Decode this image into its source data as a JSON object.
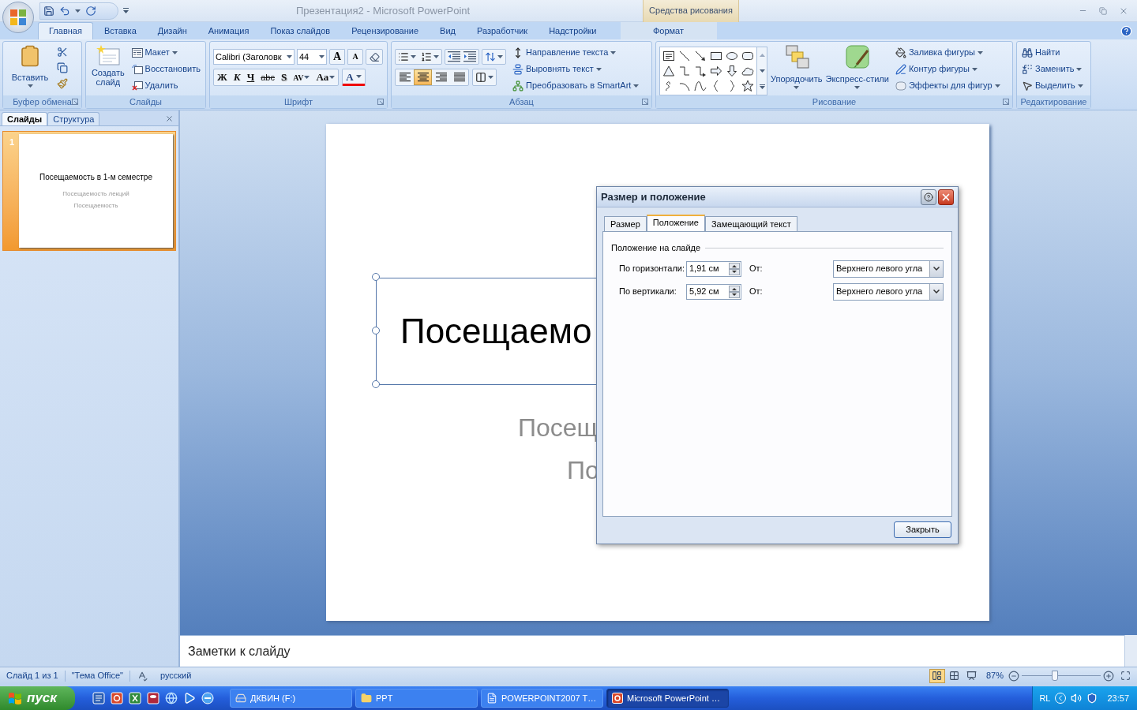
{
  "window": {
    "title": "Презентация2 - Microsoft PowerPoint",
    "contextual_group": "Средства рисования"
  },
  "ribbon_tabs": [
    {
      "label": "Главная",
      "selected": true,
      "kind": "normal"
    },
    {
      "label": "Вставка",
      "selected": false,
      "kind": "normal"
    },
    {
      "label": "Дизайн",
      "selected": false,
      "kind": "normal"
    },
    {
      "label": "Анимация",
      "selected": false,
      "kind": "normal"
    },
    {
      "label": "Показ слайдов",
      "selected": false,
      "kind": "normal"
    },
    {
      "label": "Рецензирование",
      "selected": false,
      "kind": "normal"
    },
    {
      "label": "Вид",
      "selected": false,
      "kind": "normal"
    },
    {
      "label": "Разработчик",
      "selected": false,
      "kind": "normal"
    },
    {
      "label": "Надстройки",
      "selected": false,
      "kind": "normal"
    },
    {
      "label": "Формат",
      "selected": false,
      "kind": "contextual"
    }
  ],
  "clipboard": {
    "title": "Буфер обмена",
    "paste": "Вставить"
  },
  "slides_group": {
    "title": "Слайды",
    "new_slide": "Создать слайд",
    "layout": "Макет",
    "reset": "Восстановить",
    "delete": "Удалить"
  },
  "font": {
    "title": "Шрифт",
    "name": "Calibri (Заголовк",
    "size": "44",
    "grow": "A",
    "shrink": "A",
    "color_button": "A",
    "styles": [
      {
        "label": "Ж",
        "kind": "bold"
      },
      {
        "label": "К",
        "kind": "italic"
      },
      {
        "label": "Ч",
        "kind": "underline"
      },
      {
        "label": "abc",
        "kind": "strike"
      },
      {
        "label": "S",
        "kind": "shadow"
      },
      {
        "label": "AV",
        "kind": "spacing"
      },
      {
        "label": "Aa",
        "kind": "case"
      }
    ]
  },
  "paragraph": {
    "title": "Абзац",
    "align": [
      {
        "kind": "left",
        "selected": false
      },
      {
        "kind": "center",
        "selected": true
      },
      {
        "kind": "right",
        "selected": false
      },
      {
        "kind": "justify",
        "selected": false
      }
    ],
    "commands": [
      "Направление текста",
      "Выровнять текст",
      "Преобразовать в SmartArt"
    ]
  },
  "drawing": {
    "title": "Рисование",
    "arrange": "Упорядочить",
    "quick_styles": "Экспресс-стили",
    "commands": [
      "Заливка фигуры",
      "Контур фигуры",
      "Эффекты для фигур"
    ]
  },
  "editing": {
    "title": "Редактирование",
    "commands": [
      "Найти",
      "Заменить",
      "Выделить"
    ]
  },
  "slide_pane": {
    "tabs": [
      {
        "label": "Слайды",
        "selected": true
      },
      {
        "label": "Структура",
        "selected": false
      }
    ],
    "thumbnails": [
      {
        "number": "1",
        "selected": true,
        "title": "Посещаемость в 1-м семестре",
        "lines": [
          "Посещаемость лекций",
          "Посещаемость"
        ]
      }
    ]
  },
  "slide": {
    "title": "Посещаемо",
    "subtitle_lines": [
      "Посещ",
      "По"
    ]
  },
  "notes": {
    "placeholder": "Заметки к слайду"
  },
  "dialog": {
    "title": "Размер и положение",
    "tabs": [
      {
        "label": "Размер",
        "selected": false
      },
      {
        "label": "Положение",
        "selected": true
      },
      {
        "label": "Замещающий текст",
        "selected": false
      }
    ],
    "section": "Положение на слайде",
    "rows": [
      {
        "label": "По горизонтали:",
        "value": "1,91 см",
        "from_label": "От:",
        "from_value": "Верхнего левого угла"
      },
      {
        "label": "По вертикали:",
        "value": "5,92 см",
        "from_label": "От:",
        "from_value": "Верхнего левого угла"
      }
    ],
    "close_button": "Закрыть"
  },
  "status_bar": {
    "slide": "Слайд 1 из 1",
    "theme": "\"Тема Office\"",
    "language": "русский",
    "views": [
      {
        "kind": "normal",
        "selected": true
      },
      {
        "kind": "sorter",
        "selected": false
      },
      {
        "kind": "show",
        "selected": false
      }
    ],
    "zoom": "87%",
    "zoom_slider": {
      "level": 0.42
    }
  },
  "taskbar": {
    "start": "пуск",
    "tasks": [
      {
        "label": "ДКВИН (F:)",
        "kind": "drive",
        "selected": false
      },
      {
        "label": "PPT",
        "kind": "folder",
        "selected": false
      },
      {
        "label": "POWERPOINT2007 T…",
        "kind": "document",
        "selected": false
      },
      {
        "label": "Microsoft PowerPoint …",
        "kind": "presentation",
        "selected": true
      }
    ],
    "language": "RL",
    "clock": "23:57"
  }
}
